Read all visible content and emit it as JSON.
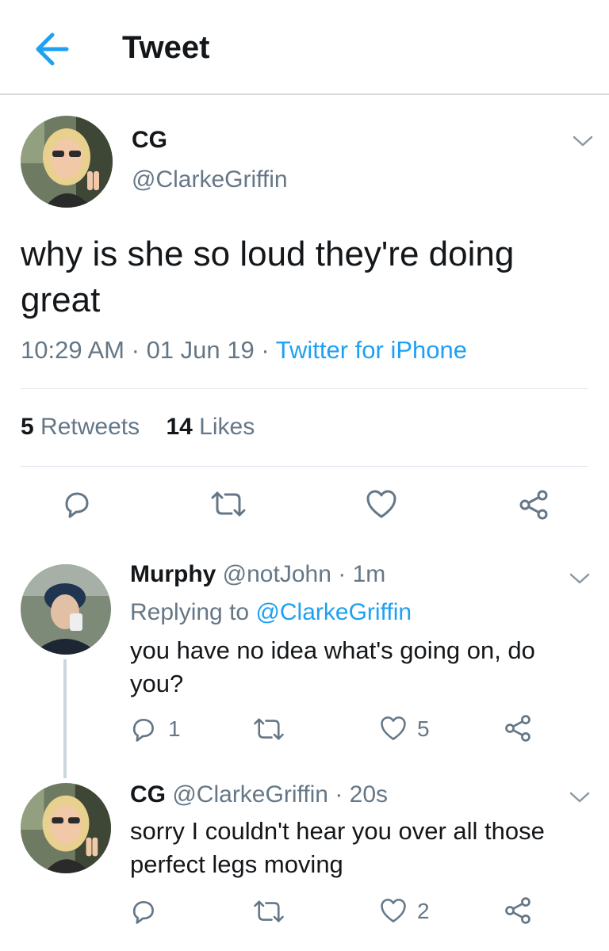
{
  "header": {
    "title": "Tweet",
    "back_icon": "arrow-left-icon",
    "accent": "#1da1f2"
  },
  "main_tweet": {
    "name": "CG",
    "handle": "@ClarkeGriffin",
    "text": "why is she so loud they're doing great",
    "time": "10:29 AM",
    "date": "01 Jun 19",
    "source": "Twitter for iPhone",
    "separator": "·",
    "retweets_count": "5",
    "retweets_label": "Retweets",
    "likes_count": "14",
    "likes_label": "Likes"
  },
  "replies": [
    {
      "name": "Murphy",
      "handle": "@notJohn",
      "time": "1m",
      "replying_prefix": "Replying to",
      "replying_to": "@ClarkeGriffin",
      "text": "you have no idea what's going on, do you?",
      "reply_count": "1",
      "like_count": "5"
    },
    {
      "name": "CG",
      "handle": "@ClarkeGriffin",
      "time": "20s",
      "text": "sorry I couldn't hear you over all those perfect legs moving",
      "like_count": "2"
    }
  ],
  "colors": {
    "text": "#14171a",
    "secondary": "#657786",
    "link": "#1da1f2",
    "divider": "#e1e8ed"
  }
}
